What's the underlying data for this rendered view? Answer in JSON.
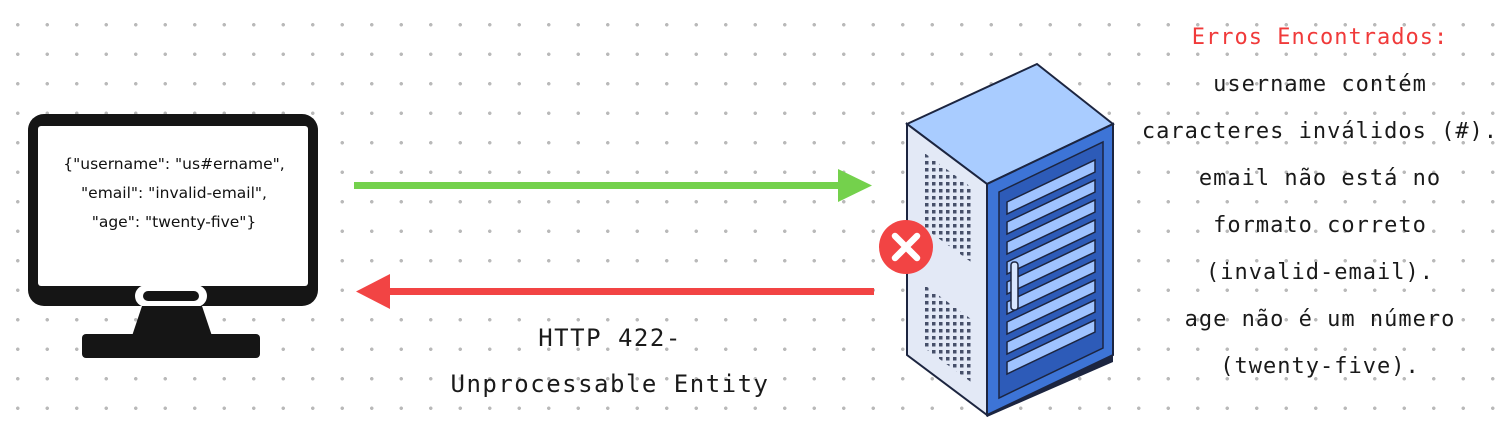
{
  "client": {
    "payload_lines": [
      "{\"username\": \"us#ername\",",
      "\"email\": \"invalid-email\",",
      "\"age\": \"twenty-five\"}"
    ]
  },
  "response": {
    "status_lines": [
      "HTTP 422-",
      "Unprocessable Entity"
    ]
  },
  "errors": {
    "title": "Erros Encontrados:",
    "lines": [
      "username contém",
      "caracteres inválidos (#).",
      "email não está no",
      "formato correto",
      "(invalid-email).",
      "age não é um número",
      "(twenty-five)."
    ]
  },
  "colors": {
    "request_arrow": "#74d14c",
    "response_arrow": "#f24444",
    "error_badge": "#f24444",
    "error_title": "#f03a3a",
    "server_blue": "#3d74d6"
  },
  "icons": {
    "client": "desktop-monitor-icon",
    "server": "server-rack-icon",
    "error": "error-x-icon"
  }
}
